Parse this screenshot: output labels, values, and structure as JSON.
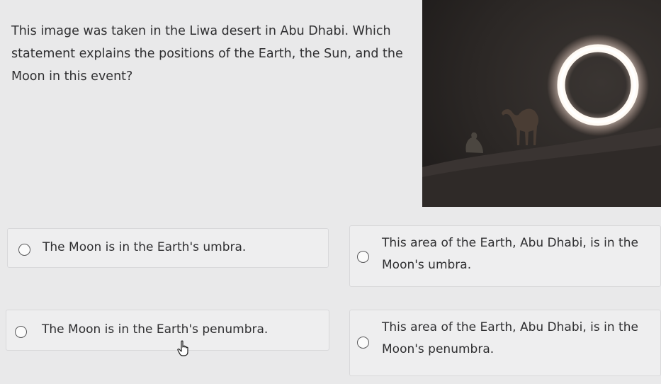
{
  "question": {
    "text": "This image was taken in the Liwa desert in Abu Dhabi. Which statement explains the positions of the Earth, the Sun, and the Moon in this event?"
  },
  "image": {
    "alt": "Annular solar eclipse over desert dunes with a camel and a person silhouetted"
  },
  "options": [
    {
      "label": "The Moon is in the Earth's umbra.",
      "selected": false
    },
    {
      "label": "This area of the Earth, Abu Dhabi, is in the Moon's umbra.",
      "selected": false
    },
    {
      "label": "The Moon is in the Earth's penumbra.",
      "selected": false
    },
    {
      "label": "This area of the Earth, Abu Dhabi, is in the Moon's penumbra.",
      "selected": false
    }
  ],
  "colors": {
    "background": "#e9e9ea",
    "option_border": "#d8d8da",
    "text": "#2f2f31",
    "eclipse_ring": "#fff6ee"
  },
  "icons": {
    "radio": "radio-button-icon",
    "cursor": "hand-pointer-icon"
  }
}
